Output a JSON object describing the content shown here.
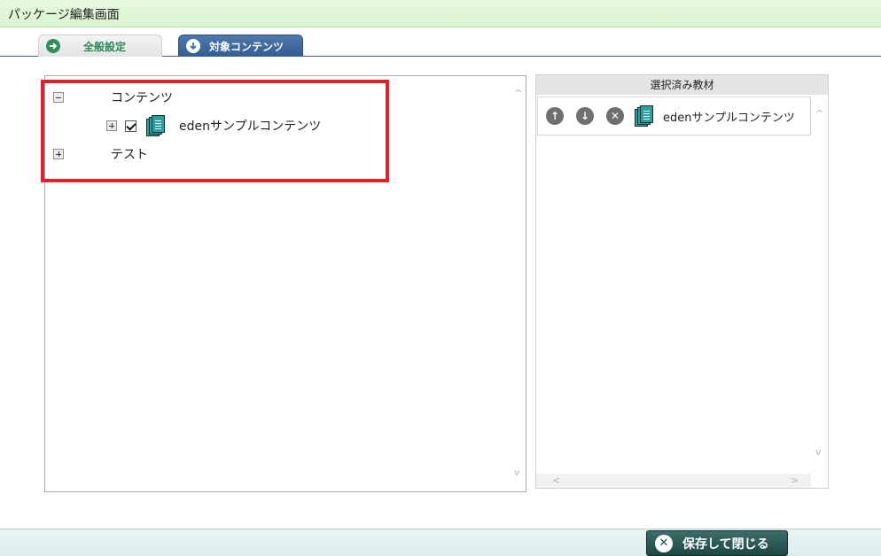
{
  "window": {
    "title": "パッケージ編集画面"
  },
  "tabs": [
    {
      "label": "全般設定",
      "icon": "arrow-right-circle-icon",
      "active": false
    },
    {
      "label": "対象コンテンツ",
      "icon": "arrow-down-circle-icon",
      "active": true
    }
  ],
  "tree": {
    "nodes": [
      {
        "label": "コンテンツ",
        "expanded": true
      },
      {
        "label": "edenサンプルコンテンツ",
        "checked": true,
        "icon": "content-book-icon"
      },
      {
        "label": "テスト",
        "expanded": false
      }
    ],
    "scroll_up": "^",
    "scroll_down": "v"
  },
  "selected": {
    "header": "選択済み教材",
    "items": [
      {
        "label": "edenサンプルコンテンツ",
        "icon": "content-book-icon"
      }
    ],
    "buttons": {
      "up": "↑",
      "down": "↓",
      "remove": "✕"
    },
    "scroll_up": "^",
    "scroll_down": "v",
    "scroll_left": "<",
    "scroll_right": ">"
  },
  "footer": {
    "save_close_label": "保存して閉じる",
    "close_glyph": "✕"
  },
  "colors": {
    "highlight": "#e1202a",
    "active_tab": "#3f6ba0",
    "footer_button": "#2d5955"
  }
}
